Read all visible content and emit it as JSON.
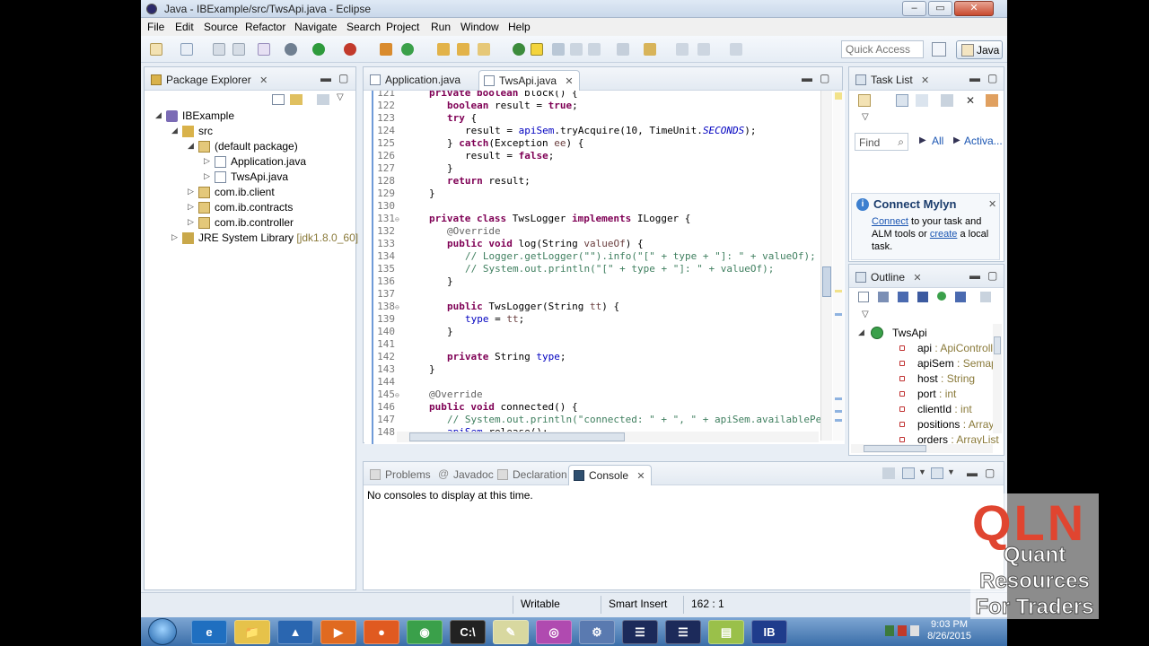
{
  "window": {
    "title": "Java - IBExample/src/TwsApi.java - Eclipse",
    "minimize": "–",
    "maximize": "▭",
    "close": "✕"
  },
  "menu": [
    "File",
    "Edit",
    "Source",
    "Refactor",
    "Navigate",
    "Search",
    "Project",
    "Run",
    "Window",
    "Help"
  ],
  "toolbar": {
    "quick_access": "Quick Access",
    "perspective": "Java"
  },
  "package_explorer": {
    "title": "Package Explorer",
    "tree": [
      {
        "label": "IBExample",
        "deco": "",
        "arrow": "◢"
      },
      {
        "label": "src",
        "deco": "",
        "arrow": "◢"
      },
      {
        "label": "(default package)",
        "deco": "",
        "arrow": "◢"
      },
      {
        "label": "Application.java",
        "deco": "",
        "arrow": "▷"
      },
      {
        "label": "TwsApi.java",
        "deco": "",
        "arrow": "▷"
      },
      {
        "label": "com.ib.client",
        "deco": "",
        "arrow": "▷"
      },
      {
        "label": "com.ib.contracts",
        "deco": "",
        "arrow": "▷"
      },
      {
        "label": "com.ib.controller",
        "deco": "",
        "arrow": "▷"
      },
      {
        "label": "JRE System Library",
        "deco": " [jdk1.8.0_60]",
        "arrow": "▷"
      }
    ]
  },
  "editor": {
    "tabs": [
      {
        "label": "Application.java",
        "active": false
      },
      {
        "label": "TwsApi.java",
        "active": true
      }
    ],
    "lines": [
      {
        "n": "121",
        "fold": "",
        "html": "<span class=\"kw\">private</span> <span class=\"kw\">boolean</span> block() {",
        "indent": 2
      },
      {
        "n": "122",
        "fold": "",
        "html": "<span class=\"kw\">boolean</span> result = <span class=\"kw\">true</span>;",
        "indent": 3
      },
      {
        "n": "123",
        "fold": "",
        "html": "<span class=\"kw\">try</span> {",
        "indent": 3
      },
      {
        "n": "124",
        "fold": "",
        "html": "result = <span class=\"fd\">apiSem</span>.tryAcquire(10, TimeUnit.<span class=\"it\">SECONDS</span>);",
        "indent": 4
      },
      {
        "n": "125",
        "fold": "",
        "html": "} <span class=\"kw\">catch</span>(Exception <span class=\"pv\">ee</span>) {",
        "indent": 3
      },
      {
        "n": "126",
        "fold": "",
        "html": "result = <span class=\"kw\">false</span>;",
        "indent": 4
      },
      {
        "n": "127",
        "fold": "",
        "html": "}",
        "indent": 3
      },
      {
        "n": "128",
        "fold": "",
        "html": "<span class=\"kw\">return</span> result;",
        "indent": 3
      },
      {
        "n": "129",
        "fold": "",
        "html": "}",
        "indent": 2
      },
      {
        "n": "130",
        "fold": "",
        "html": "",
        "indent": 2
      },
      {
        "n": "131",
        "fold": "⊖",
        "html": "<span class=\"kw\">private</span> <span class=\"kw\">class</span> TwsLogger <span class=\"kw\">implements</span> ILogger {",
        "indent": 2
      },
      {
        "n": "132",
        "fold": "",
        "html": "<span class=\"an\">@Override</span>",
        "indent": 3
      },
      {
        "n": "133",
        "fold": "",
        "html": "<span class=\"kw\">public</span> <span class=\"kw\">void</span> log(String <span class=\"pv\">valueOf</span>) {",
        "indent": 3
      },
      {
        "n": "134",
        "fold": "",
        "html": "<span class=\"cm\">// Logger.getLogger(\"\").info(\"[\" + type + \"]: \" + valueOf);</span>",
        "indent": 4
      },
      {
        "n": "135",
        "fold": "",
        "html": "<span class=\"cm\">// System.out.println(\"[\" + type + \"]: \" + valueOf);</span>",
        "indent": 4
      },
      {
        "n": "136",
        "fold": "",
        "html": "}",
        "indent": 3
      },
      {
        "n": "137",
        "fold": "",
        "html": "",
        "indent": 3
      },
      {
        "n": "138",
        "fold": "⊖",
        "html": "<span class=\"kw\">public</span> TwsLogger(String <span class=\"pv\">tt</span>) {",
        "indent": 3
      },
      {
        "n": "139",
        "fold": "",
        "html": "<span class=\"fd\">type</span> = <span class=\"pv\">tt</span>;",
        "indent": 4
      },
      {
        "n": "140",
        "fold": "",
        "html": "}",
        "indent": 3
      },
      {
        "n": "141",
        "fold": "",
        "html": "",
        "indent": 3
      },
      {
        "n": "142",
        "fold": "",
        "html": "<span class=\"kw\">private</span> String <span class=\"fd\">type</span>;",
        "indent": 3
      },
      {
        "n": "143",
        "fold": "",
        "html": "}",
        "indent": 2
      },
      {
        "n": "144",
        "fold": "",
        "html": "",
        "indent": 2
      },
      {
        "n": "145",
        "fold": "⊖",
        "html": "<span class=\"an\">@Override</span>",
        "indent": 2
      },
      {
        "n": "146",
        "fold": "",
        "html": "<span class=\"kw\">public</span> <span class=\"kw\">void</span> connected() {",
        "indent": 2
      },
      {
        "n": "147",
        "fold": "",
        "html": "<span class=\"cm\">// System.out.println(\"connected: \" + \", \" + apiSem.availablePer</span>",
        "indent": 3
      },
      {
        "n": "148",
        "fold": "",
        "html": "<span class=\"fd\">apiSem</span>.release();",
        "indent": 3
      }
    ]
  },
  "task_list": {
    "title": "Task List",
    "find_placeholder": "Find",
    "all": "All",
    "activate": "Activa..."
  },
  "mylyn": {
    "title": "Connect Mylyn",
    "connect": "Connect",
    "text1": " to your task and ALM tools or ",
    "create": "create",
    "text2": " a local task."
  },
  "outline": {
    "title": "Outline",
    "root": "TwsApi",
    "items": [
      {
        "name": "api",
        "type": " : ApiControll"
      },
      {
        "name": "apiSem",
        "type": " : Semapl"
      },
      {
        "name": "host",
        "type": " : String"
      },
      {
        "name": "port",
        "type": " : int"
      },
      {
        "name": "clientId",
        "type": " : int"
      },
      {
        "name": "positions",
        "type": " : Array"
      },
      {
        "name": "orders",
        "type": " : ArrayList"
      }
    ]
  },
  "bottom_panel": {
    "tabs": [
      "Problems",
      "Javadoc",
      "Declaration",
      "Console"
    ],
    "console_text": "No consoles to display at this time."
  },
  "status": {
    "writable": "Writable",
    "insert": "Smart Insert",
    "position": "162 : 1"
  },
  "taskbar": {
    "apps": [
      "e",
      "📁",
      "▲",
      "▶",
      "●",
      "◉",
      "C:\\",
      "✎",
      "◎",
      "⚙",
      "☰",
      "☰",
      "▤",
      "IB"
    ],
    "time": "9:03 PM",
    "date": "8/26/2015"
  },
  "watermark": {
    "logo": "QLN",
    "line1": "Quant",
    "line2": "Resources",
    "line3": "For Traders"
  }
}
